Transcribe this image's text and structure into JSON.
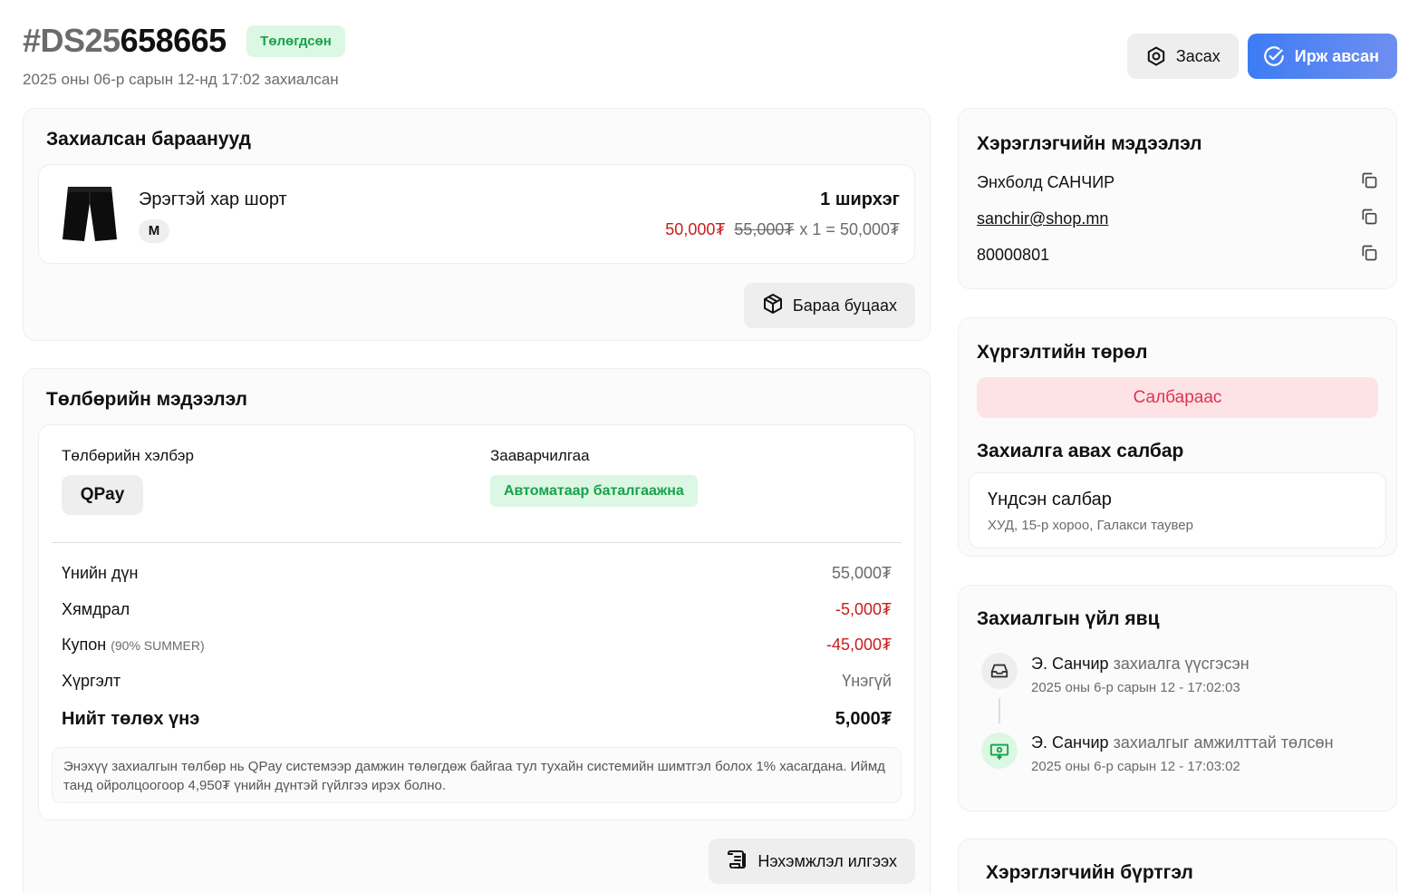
{
  "header": {
    "order_prefix": "#DS25",
    "order_number": "658665",
    "status": "Төлөгдсөн",
    "date": "2025 оны 06-р сарын 12-нд 17:02 захиалсан"
  },
  "actions": {
    "edit_label": "Засах",
    "received_label": "Ирж авсан"
  },
  "items_card": {
    "title": "Захиалсан бараанууд",
    "items": [
      {
        "name": "Эрэгтэй хар шорт",
        "size": "M",
        "quantity": "1 ширхэг",
        "sale_price": "50,000₮",
        "original_price": "55,000₮",
        "calc": "x 1 = 50,000₮"
      }
    ],
    "return_label": "Бараа буцаах"
  },
  "payment_card": {
    "title": "Төлбөрийн мэдээлэл",
    "method_label": "Төлбөрийн хэлбэр",
    "method_value": "QPay",
    "instruction_label": "Зааварчилгаа",
    "instruction_value": "Автоматаар баталгаажна",
    "rows": {
      "subtotal_label": "Үнийн дүн",
      "subtotal_value": "55,000₮",
      "discount_label": "Хямдрал",
      "discount_value": "-5,000₮",
      "coupon_label": "Купон",
      "coupon_code": "(90% SUMMER)",
      "coupon_value": "-45,000₮",
      "shipping_label": "Хүргэлт",
      "shipping_value": "Үнэгүй",
      "total_label": "Нийт төлөх үнэ",
      "total_value": "5,000₮"
    },
    "note": "Энэхүү захиалгын төлбөр нь QPay системээр дамжин төлөгдөж байгаа тул тухайн системийн шимтгэл болох 1% хасагдана. Иймд танд ойролцоогоор 4,950₮ үнийн дүнтэй гүйлгээ ирэх болно.",
    "invoice_label": "Нэхэмжлэл илгээх"
  },
  "customer_card": {
    "title": "Хэрэглэгчийн мэдээлэл",
    "name": "Энхболд САНЧИР",
    "email": "sanchir@shop.mn",
    "phone": "80000801"
  },
  "delivery_card": {
    "title": "Хүргэлтийн төрөл",
    "type": "Салбараас",
    "branch_title": "Захиалга авах салбар",
    "branch_name": "Үндсэн салбар",
    "branch_address": "ХУД, 15-р хороо, Галакси таувер"
  },
  "timeline_card": {
    "title": "Захиалгын үйл явц",
    "events": [
      {
        "actor": "Э. Санчир",
        "action": "захиалга үүсгэсэн",
        "time": "2025 оны 6-р сарын 12 - 17:02:03",
        "icon": "inbox-icon"
      },
      {
        "actor": "Э. Санчир",
        "action": "захиалгыг амжилттай төлсөн",
        "time": "2025 оны 6-р сарын 12 - 17:03:02",
        "icon": "payment-icon"
      }
    ]
  },
  "registration_card": {
    "title": "Хэрэглэгчийн бүртгэл"
  },
  "colors": {
    "accent_blue": "#3d7cf4",
    "success_green": "#17a34a",
    "danger_red": "#c81e1e",
    "pink_text": "#e0334f"
  }
}
